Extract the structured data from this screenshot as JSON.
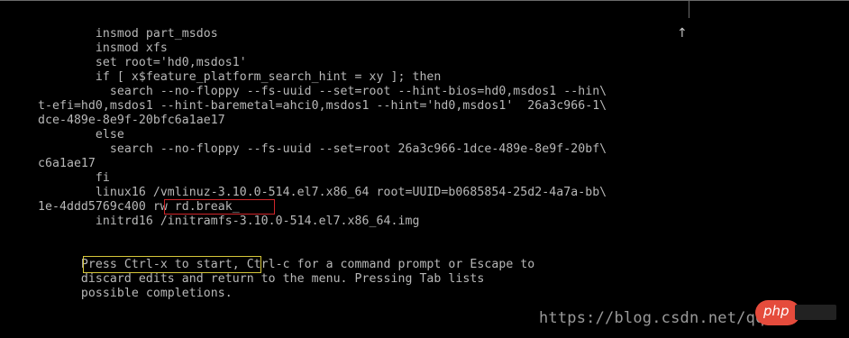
{
  "terminal": {
    "lines": [
      "        insmod part_msdos",
      "        insmod xfs",
      "        set root='hd0,msdos1'",
      "        if [ x$feature_platform_search_hint = xy ]; then",
      "          search --no-floppy --fs-uuid --set=root --hint-bios=hd0,msdos1 --hin\\",
      "t-efi=hd0,msdos1 --hint-baremetal=ahci0,msdos1 --hint='hd0,msdos1'  26a3c966-1\\",
      "dce-489e-8e9f-20bfc6a1ae17",
      "        else",
      "          search --no-floppy --fs-uuid --set=root 26a3c966-1dce-489e-8e9f-20bf\\",
      "c6a1ae17",
      "        fi",
      "        linux16 /vmlinuz-3.10.0-514.el7.x86_64 root=UUID=b0685854-25d2-4a7a-bb\\",
      "1e-4ddd5769c400 rw rd.break_",
      "        initrd16 /initramfs-3.10.0-514.el7.x86_64.img",
      "",
      "",
      "      Press Ctrl-x to start, Ctrl-c for a command prompt or Escape to",
      "      discard edits and return to the menu. Pressing Tab lists",
      "      possible completions."
    ],
    "scroll_indicator": "↑"
  },
  "annotations": {
    "highlight_edit": "rw rd.break_",
    "highlight_start": "Press Ctrl-x to start"
  },
  "watermark": {
    "url": "https://blog.csdn.net/qq",
    "logo_text": "php"
  },
  "colors": {
    "background": "#000000",
    "text": "#b8b8b8",
    "edit_highlight": "#d0262a",
    "start_highlight": "#d6c63a",
    "logo": "#e54b3c"
  }
}
